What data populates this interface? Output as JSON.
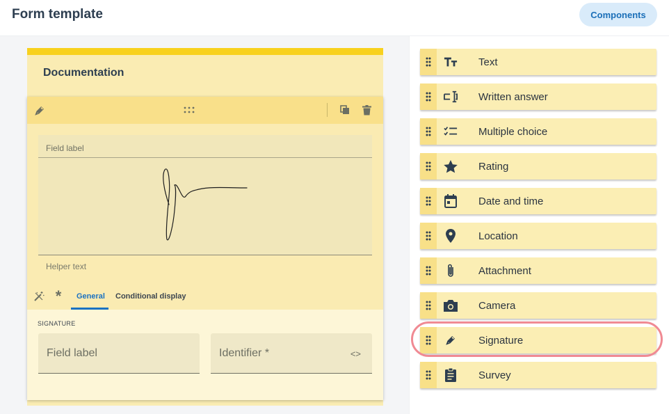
{
  "header": {
    "title": "Form template",
    "components_button": "Components"
  },
  "card": {
    "title": "Documentation"
  },
  "field": {
    "signature_label": "Field label",
    "helper_text": "Helper text",
    "tabs": [
      {
        "label": "General",
        "active": true
      },
      {
        "label": "Conditional display",
        "active": false
      }
    ],
    "section_label": "SIGNATURE",
    "field_label_placeholder": "Field label",
    "identifier_placeholder": "Identifier *",
    "identifier_icon": "<>"
  },
  "components": [
    {
      "label": "Text",
      "icon": "text-format-icon"
    },
    {
      "label": "Written answer",
      "icon": "text-field-icon"
    },
    {
      "label": "Multiple choice",
      "icon": "checklist-icon"
    },
    {
      "label": "Rating",
      "icon": "star-icon"
    },
    {
      "label": "Date and time",
      "icon": "calendar-icon"
    },
    {
      "label": "Location",
      "icon": "location-pin-icon"
    },
    {
      "label": "Attachment",
      "icon": "paperclip-icon"
    },
    {
      "label": "Camera",
      "icon": "camera-icon"
    },
    {
      "label": "Signature",
      "icon": "pen-nib-icon",
      "highlighted": true
    },
    {
      "label": "Survey",
      "icon": "clipboard-icon"
    }
  ],
  "colors": {
    "accent": "#1b72c1",
    "card_bar": "#f8d11e",
    "component_bg": "#fbeeb4",
    "highlight_ring": "#f08a93",
    "icon": "#2d3e50"
  }
}
